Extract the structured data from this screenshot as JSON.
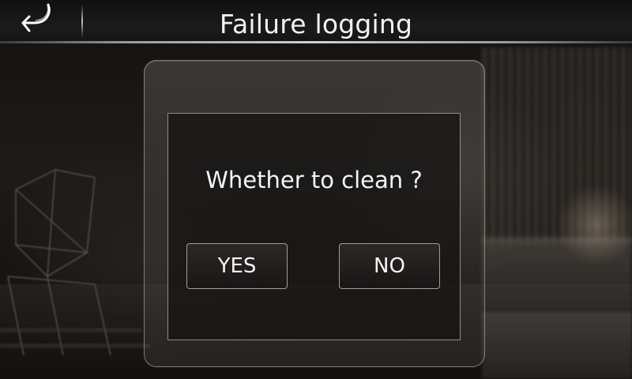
{
  "header": {
    "title": "Failure logging",
    "back_icon": "back-arrow-icon"
  },
  "dialog": {
    "message": "Whether to clean ?",
    "yes_label": "YES",
    "no_label": "NO"
  },
  "colors": {
    "text": "#f4f4f4",
    "header_bg": "#1b1b1b",
    "dialog_border": "#b9b4af"
  }
}
